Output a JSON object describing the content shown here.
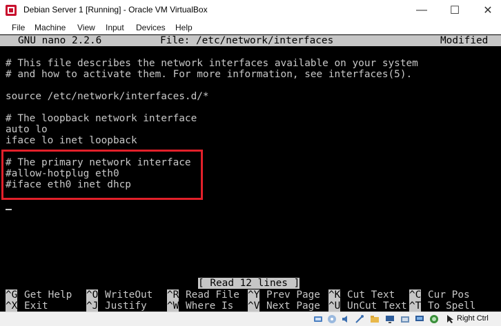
{
  "window": {
    "title": "Debian Server 1 [Running] - Oracle VM VirtualBox",
    "controls": {
      "minimize": "—",
      "maximize": "☐",
      "close": "✕"
    }
  },
  "menubar": [
    "File",
    "Machine",
    "View",
    "Input",
    "Devices",
    "Help"
  ],
  "nano": {
    "version": "GNU nano 2.2.6",
    "file": "File: /etc/network/interfaces",
    "state": "Modified",
    "lines": [
      "# This file describes the network interfaces available on your system",
      "# and how to activate them. For more information, see interfaces(5).",
      "",
      "source /etc/network/interfaces.d/*",
      "",
      "# The loopback network interface",
      "auto lo",
      "iface lo inet loopback",
      "",
      "# The primary network interface",
      "#allow-hotplug eth0",
      "#iface eth0 inet dhcp"
    ],
    "status_message": "[ Read 12 lines ]",
    "shortcuts_row1": [
      {
        "key": "^G",
        "label": "Get Help"
      },
      {
        "key": "^O",
        "label": "WriteOut"
      },
      {
        "key": "^R",
        "label": "Read File"
      },
      {
        "key": "^Y",
        "label": "Prev Page"
      },
      {
        "key": "^K",
        "label": "Cut Text"
      },
      {
        "key": "^C",
        "label": "Cur Pos"
      }
    ],
    "shortcuts_row2": [
      {
        "key": "^X",
        "label": "Exit"
      },
      {
        "key": "^J",
        "label": "Justify"
      },
      {
        "key": "^W",
        "label": "Where Is"
      },
      {
        "key": "^V",
        "label": "Next Page"
      },
      {
        "key": "^U",
        "label": "UnCut Text"
      },
      {
        "key": "^T",
        "label": "To Spell"
      }
    ]
  },
  "statusbar": {
    "host_key": "Right Ctrl",
    "icons": [
      "hard-disk-icon",
      "optical-drive-icon",
      "audio-icon",
      "usb-icon",
      "shared-folders-icon",
      "display-icon",
      "video-capture-icon",
      "network-icon",
      "cpu-icon",
      "mouse-integration-icon"
    ]
  },
  "colors": {
    "terminal_bg": "#000000",
    "terminal_fg": "#c8c8c8",
    "nano_bar": "#c6c6c6",
    "highlight": "#e2202a"
  }
}
